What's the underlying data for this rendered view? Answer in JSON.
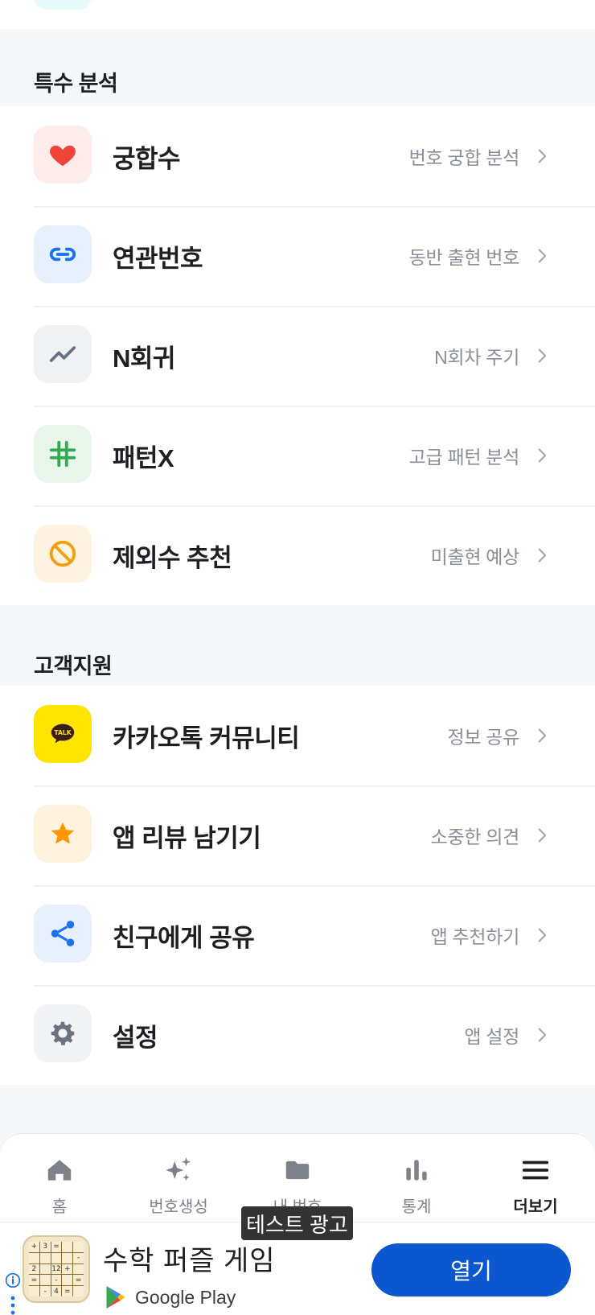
{
  "sections": {
    "special": {
      "header": "특수 분석",
      "items": [
        {
          "title": "궁합수",
          "sub": "번호 궁합 분석",
          "icon": "heart-icon"
        },
        {
          "title": "연관번호",
          "sub": "동반 출현 번호",
          "icon": "link-icon"
        },
        {
          "title": "N회귀",
          "sub": "N회차 주기",
          "icon": "trend-icon"
        },
        {
          "title": "패턴X",
          "sub": "고급 패턴 분석",
          "icon": "grid-icon"
        },
        {
          "title": "제외수 추천",
          "sub": "미출현 예상",
          "icon": "block-icon"
        }
      ]
    },
    "support": {
      "header": "고객지원",
      "items": [
        {
          "title": "카카오톡 커뮤니티",
          "sub": "정보 공유",
          "icon": "kakao-talk-icon",
          "icon_text": "TALK"
        },
        {
          "title": "앱 리뷰 남기기",
          "sub": "소중한 의견",
          "icon": "star-icon"
        },
        {
          "title": "친구에게 공유",
          "sub": "앱 추천하기",
          "icon": "share-icon"
        },
        {
          "title": "설정",
          "sub": "앱 설정",
          "icon": "gear-icon"
        }
      ]
    }
  },
  "nav": {
    "items": [
      {
        "label": "홈",
        "icon": "home-icon"
      },
      {
        "label": "번호생성",
        "icon": "sparkle-icon"
      },
      {
        "label": "내 번호",
        "icon": "folder-icon"
      },
      {
        "label": "통계",
        "icon": "bar-chart-icon"
      },
      {
        "label": "더보기",
        "icon": "menu-icon",
        "active": true
      }
    ]
  },
  "ad": {
    "tag": "테스트 광고",
    "title": "수학 퍼즐 게임",
    "store": "Google Play",
    "button": "열기",
    "puzzle_cells": [
      "+",
      "3",
      "=",
      "",
      "",
      "",
      "",
      "",
      "",
      "-",
      "2",
      "",
      "12",
      "+",
      "",
      "=",
      "",
      "-",
      "",
      "=",
      "",
      "-",
      "4",
      "=",
      ""
    ]
  },
  "colors": {
    "accent": "#0b57d0",
    "heart": "#f04438",
    "link": "#1a73e8",
    "trend": "#667085",
    "grid": "#34a853",
    "block": "#f59e0b",
    "kakao": "#fee500",
    "star": "#ff9800",
    "share": "#1a73e8",
    "gear": "#6b7280"
  }
}
